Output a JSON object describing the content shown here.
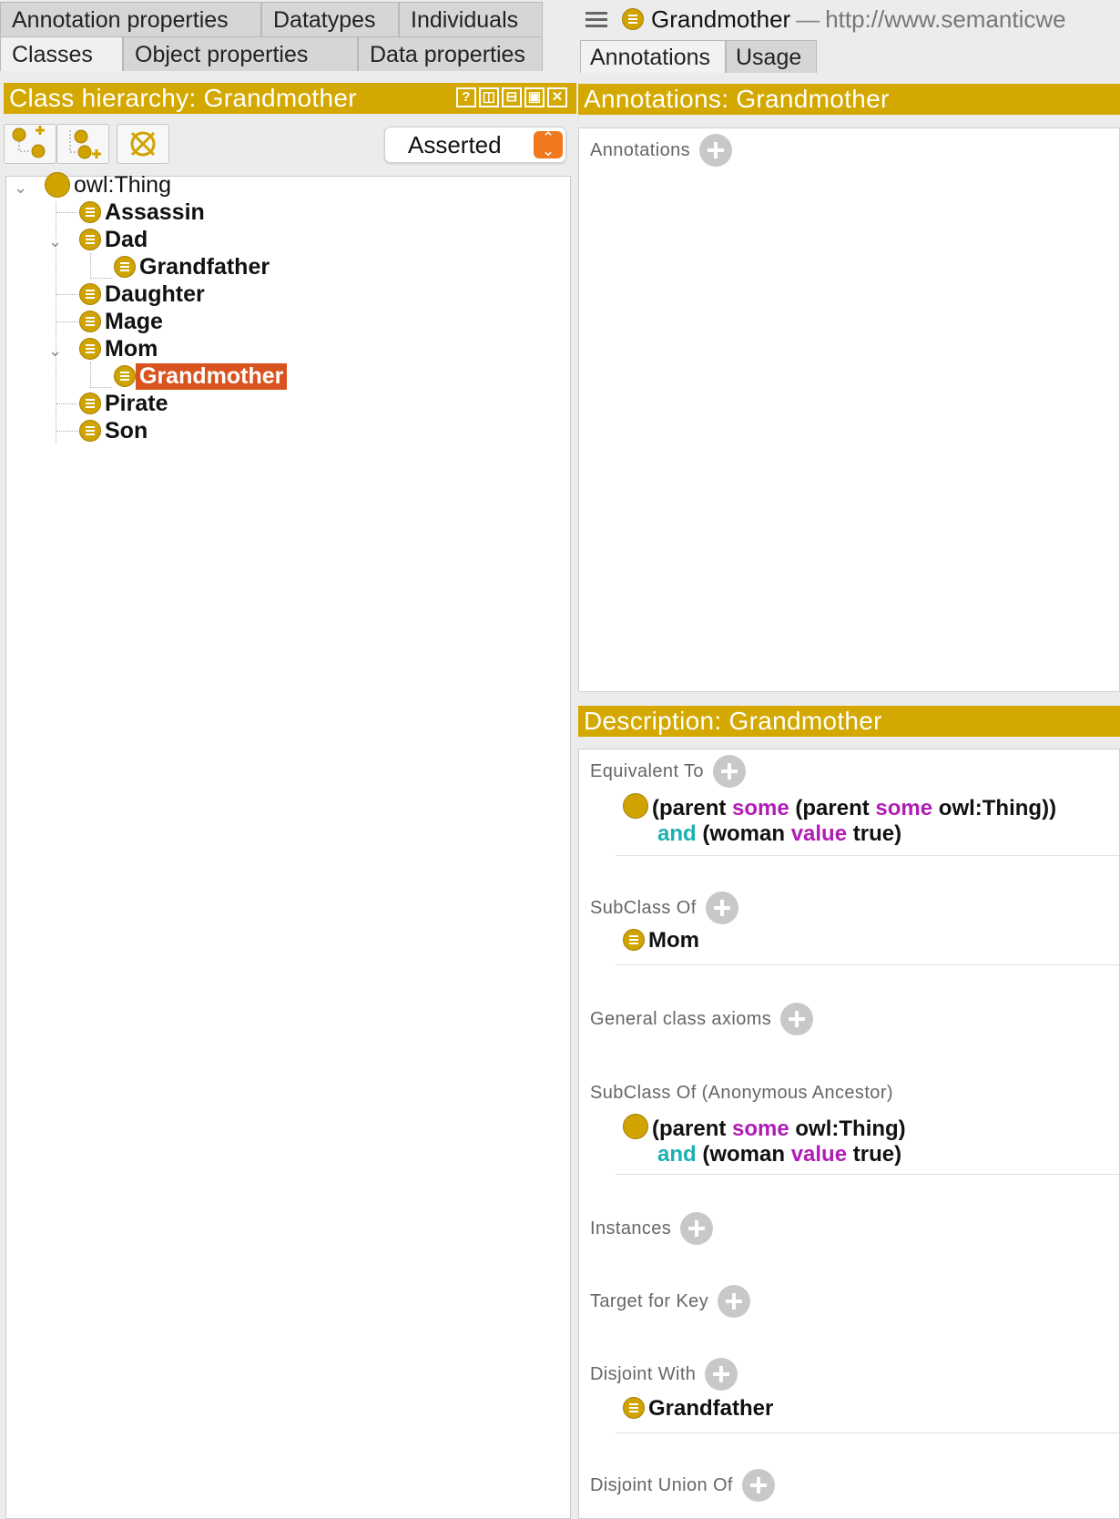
{
  "left_tabs": {
    "row1": [
      "Annotation properties",
      "Datatypes",
      "Individuals"
    ],
    "row2": [
      "Classes",
      "Object properties",
      "Data properties"
    ]
  },
  "class_hierarchy": {
    "title": "Class hierarchy: Grandmother",
    "view_buttons": [
      "?",
      "◫",
      "⊟",
      "▣",
      "✕"
    ],
    "toolbar": {
      "add_subclass_icon": "add-subclass-icon",
      "add_sibling_icon": "add-sibling-icon",
      "delete_icon": "delete-class-icon",
      "mode": "Asserted",
      "mode_arrows": "⌃⌄"
    },
    "tree": {
      "root": "owl:Thing",
      "items": [
        {
          "label": "Assassin"
        },
        {
          "label": "Dad"
        },
        {
          "label": "Grandfather"
        },
        {
          "label": "Daughter"
        },
        {
          "label": "Mage"
        },
        {
          "label": "Mom"
        },
        {
          "label": "Grandmother",
          "selected": true
        },
        {
          "label": "Pirate"
        },
        {
          "label": "Son"
        }
      ]
    }
  },
  "header": {
    "entity": "Grandmother",
    "separator": "—",
    "iri": "http://www.semanticwe"
  },
  "right_tabs": [
    "Annotations",
    "Usage"
  ],
  "annotations_view": {
    "title": "Annotations: Grandmother",
    "section": "Annotations"
  },
  "description_view": {
    "title": "Description: Grandmother",
    "sections": {
      "equivalent_to": "Equivalent To",
      "subclass_of": "SubClass Of",
      "general_axioms": "General class axioms",
      "anon_ancestor": "SubClass Of (Anonymous Ancestor)",
      "instances": "Instances",
      "target_for_key": "Target for Key",
      "disjoint_with": "Disjoint With",
      "disjoint_union_of": "Disjoint Union Of"
    },
    "equivalent_expr": {
      "p1": "(parent ",
      "k1": "some",
      "p2": " (parent ",
      "k2": "some",
      "p3": " owl:Thing))",
      "and": "and",
      "p4": " (woman ",
      "k3": "value",
      "p5": " true)"
    },
    "subclass_of_value": "Mom",
    "anon_expr": {
      "p1": "(parent ",
      "k1": "some",
      "p2": " owl:Thing)",
      "and": "and",
      "p4": " (woman ",
      "k3": "value",
      "p5": " true)"
    },
    "disjoint_with_value": "Grandfather"
  },
  "colors": {
    "view_header": "#d3a800",
    "selection": "#d9531e",
    "keyword_purple": "#b01cb5",
    "keyword_teal": "#1bb0b0",
    "class_icon": "#d1a300"
  }
}
